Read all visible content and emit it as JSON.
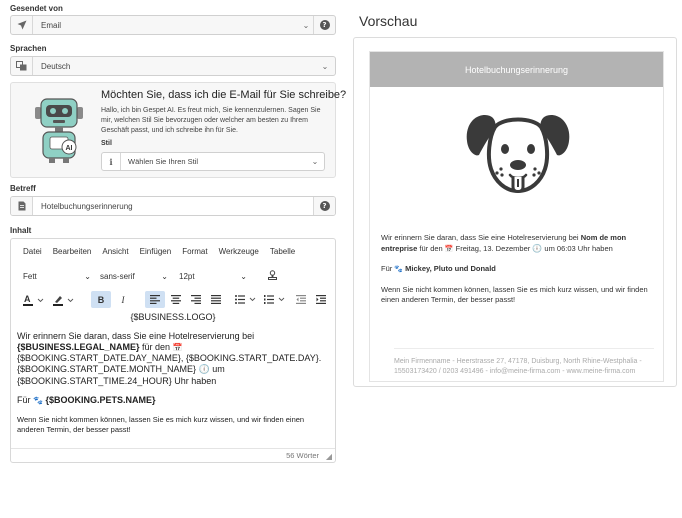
{
  "form": {
    "sent_from": {
      "label": "Gesendet von",
      "value": "Email",
      "icon": "send-icon"
    },
    "languages": {
      "label": "Sprachen",
      "value": "Deutsch",
      "icon": "translate-icon"
    },
    "ai": {
      "title": "Möchten Sie, dass ich die E-Mail für Sie schreibe?",
      "description": "Hallo, ich bin Gespet AI. Es freut mich, Sie kennenzulernen. Sagen Sie mir, welchen Stil Sie bevorzugen oder welcher am besten zu Ihrem Geschäft passt, und ich schreibe ihn für Sie.",
      "style_label": "Stil",
      "style_placeholder": "Wählen Sie Ihren Stil",
      "robot_badge": "AI"
    },
    "subject": {
      "label": "Betreff",
      "value": "Hotelbuchungserinnerung"
    },
    "content_label": "Inhalt"
  },
  "editor": {
    "menu": [
      "Datei",
      "Bearbeiten",
      "Ansicht",
      "Einfügen",
      "Format",
      "Werkzeuge",
      "Tabelle"
    ],
    "format_select": "Fett",
    "font_select": "sans-serif",
    "size_select": "12pt",
    "bold": "B",
    "italic": "I",
    "content": {
      "logo": "{$BUSINESS.LOGO}",
      "p1_a": "Wir erinnern Sie daran, dass Sie eine Hotelreservierung bei",
      "p1_b": "{$BUSINESS.LEGAL_NAME}",
      "p1_c": "für den",
      "p1_d": "{$BOOKING.START_DATE.DAY_NAME}, {$BOOKING.START_DATE.DAY}. {$BOOKING.START_DATE.MONTH_NAME}",
      "p1_e": "um {$BOOKING.START_TIME.24_HOUR} Uhr haben",
      "p2_a": "Für",
      "p2_b": "{$BOOKING.PETS.NAME}",
      "p3": "Wenn Sie nicht kommen können, lassen Sie es mich kurz wissen, und wir finden einen anderen Termin, der besser passt!"
    },
    "word_count": "56 Wörter"
  },
  "preview": {
    "title": "Vorschau",
    "header": "Hotelbuchungserinnerung",
    "p1_a": "Wir erinnern Sie daran, dass Sie eine Hotelreservierung bei",
    "p1_b": "Nom de mon entreprise",
    "p1_c": "für den",
    "p1_d": "Freitag, 13. Dezember",
    "p1_e": "um 06:03 Uhr haben",
    "p2_a": "Für",
    "p2_b": "Mickey, Pluto und Donald",
    "p3": "Wenn Sie nicht kommen können, lassen Sie es mich kurz wissen, und wir finden einen anderen Termin, der besser passt!",
    "footer": "Mein Firmenname - Heerstrasse 27, 47178, Duisburg, North Rhine-Westphalia - 15503173420 / 0203 491496 - info@meine-firma.com - www.meine-firma.com"
  },
  "colors": {
    "accent_active": "#cfe0f3",
    "preview_header": "#b3b3b3",
    "dog": "#3a3a3a"
  }
}
